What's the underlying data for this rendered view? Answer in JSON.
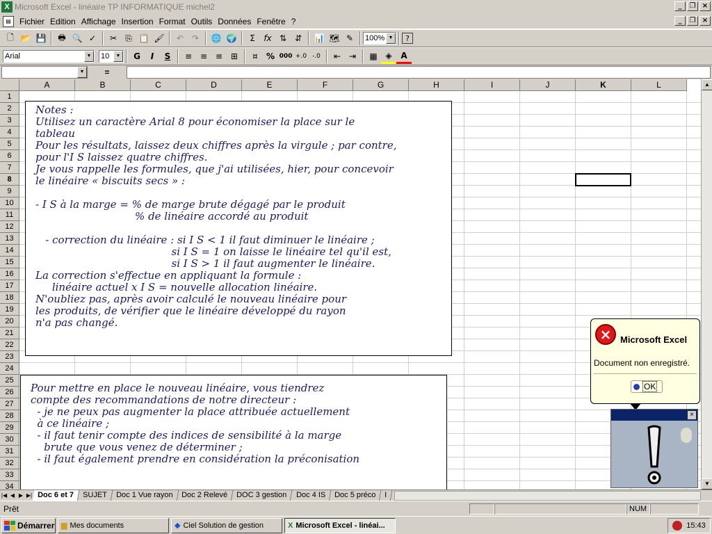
{
  "window": {
    "title": "Microsoft Excel - linéaire TP INFORMATIQUE michel2"
  },
  "menu": [
    "Fichier",
    "Edition",
    "Affichage",
    "Insertion",
    "Format",
    "Outils",
    "Données",
    "Fenêtre",
    "?"
  ],
  "toolbar": {
    "zoom": "100%"
  },
  "format": {
    "font": "Arial",
    "size": "10",
    "bold": "G",
    "italic": "I",
    "underline": "S",
    "percent": "%",
    "thousands": "000"
  },
  "formula": {
    "name_box": "",
    "equals": "=",
    "content": ""
  },
  "columns": [
    "A",
    "B",
    "C",
    "D",
    "E",
    "F",
    "G",
    "H",
    "I",
    "J",
    "K",
    "L"
  ],
  "rows": [
    "1",
    "2",
    "3",
    "4",
    "5",
    "6",
    "7",
    "8",
    "9",
    "10",
    "11",
    "12",
    "13",
    "14",
    "15",
    "16",
    "17",
    "18",
    "19",
    "20",
    "21",
    "22",
    "23",
    "24",
    "25",
    "26",
    "27",
    "28",
    "29",
    "30",
    "31",
    "32",
    "33",
    "34"
  ],
  "note1": {
    "lines": [
      "Notes :",
      "Utilisez un caractère Arial 8 pour économiser la place sur le",
      "tableau",
      "Pour les résultats, laissez deux chiffres après la virgule ; par contre,",
      "pour l'I S laissez quatre chiffres.",
      "Je vous rappelle les formules, que j'ai utilisées, hier, pour concevoir",
      "le linéaire « biscuits secs » :",
      "",
      "- I S à la marge = % de marge brute dégagé par le produit",
      "                              % de linéaire accordé au produit",
      "",
      "   - correction du linéaire : si I S < 1 il faut diminuer le linéaire ;",
      "                                         si I S = 1 on laisse le linéaire tel qu'il est,",
      "                                         si I S > 1 il faut augmenter le linéaire.",
      "La correction s'effectue en appliquant la formule :",
      "     linéaire actuel x I S = nouvelle allocation linéaire.",
      "N'oubliez pas, après avoir calculé le nouveau linéaire pour",
      "les produits, de vérifier que le linéaire développé du rayon",
      "n'a pas changé."
    ]
  },
  "note2": {
    "lines": [
      "Pour mettre en place le nouveau linéaire, vous tiendrez",
      "compte des recommandations de notre directeur :",
      "  - je ne peux pas augmenter la place attribuée actuellement",
      "  à ce linéaire ;",
      "  - il faut tenir compte des indices de sensibilité à la marge",
      "    brute que vous venez de déterminer ;",
      "  - il faut également prendre en considération la préconisation"
    ]
  },
  "tabs": [
    "Doc 6 et 7",
    "SUJET",
    "Doc 1  Vue rayon",
    "Doc 2 Relevé",
    "DOC 3 gestion",
    "Doc 4  IS",
    "Doc 5 préco",
    "I"
  ],
  "status": {
    "text": "Prêt",
    "num": "NUM"
  },
  "taskbar": {
    "start": "Démarrer",
    "tasks": [
      "Mes documents",
      "Ciel Solution de gestion",
      "Microsoft Excel - linéai..."
    ],
    "clock": "15:43"
  },
  "balloon": {
    "title": "Microsoft Excel",
    "message": "Document non enregistré.",
    "ok": "OK"
  },
  "icons": {
    "error": "error-icon",
    "exclamation": "exclamation-icon"
  }
}
